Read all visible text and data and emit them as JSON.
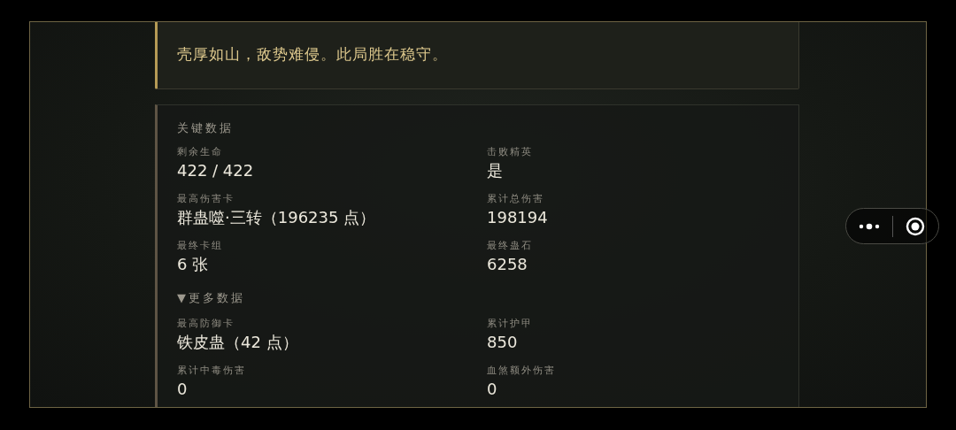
{
  "review": {
    "text": "壳厚如山，敌势难侵。此局胜在稳守。"
  },
  "key_data": {
    "title": "关键数据",
    "stats": [
      {
        "label": "剩余生命",
        "value": "422 / 422"
      },
      {
        "label": "击败精英",
        "value": "是"
      },
      {
        "label": "最高伤害卡",
        "value": "群蛊噬·三转（196235 点）"
      },
      {
        "label": "累计总伤害",
        "value": "198194"
      },
      {
        "label": "最终卡组",
        "value": "6 张"
      },
      {
        "label": "最终蛊石",
        "value": "6258"
      }
    ]
  },
  "more_data": {
    "toggle": "▼更多数据",
    "stats": [
      {
        "label": "最高防御卡",
        "value": "铁皮蛊（42 点）"
      },
      {
        "label": "累计护甲",
        "value": "850"
      },
      {
        "label": "累计中毒伤害",
        "value": "0"
      },
      {
        "label": "血煞额外伤害",
        "value": "0"
      }
    ]
  }
}
